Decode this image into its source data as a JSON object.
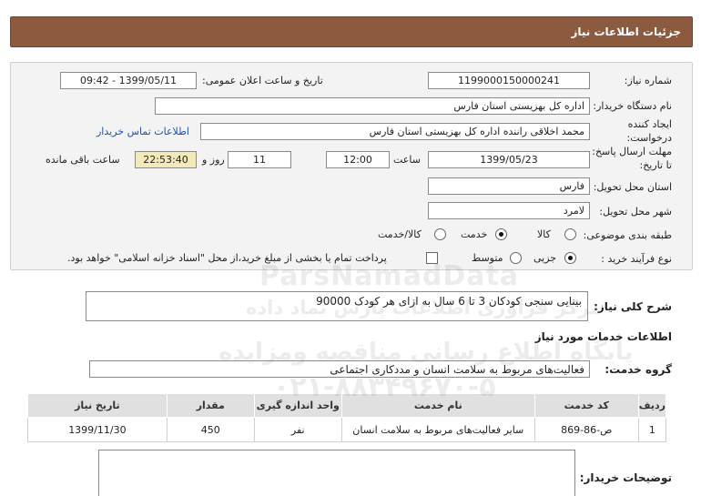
{
  "header": {
    "title": "جزئیات اطلاعات نیاز"
  },
  "form": {
    "need_number_label": "شماره نیاز:",
    "need_number": "1199000150000241",
    "announce_label": "تاریخ و ساعت اعلان عمومی:",
    "announce_value": "1399/05/11 - 09:42",
    "buyer_org_label": "نام دستگاه خریدار:",
    "buyer_org": "اداره کل بهزیستی استان فارس",
    "creator_label_1": "ایجاد کننده",
    "creator_label_2": "درخواست:",
    "creator": "محمد  اخلاقی راننده اداره کل بهزیستی استان فارس",
    "contact_link": "اطلاعات تماس خریدار",
    "deadline_label_1": "مهلت ارسال پاسخ:",
    "deadline_label_2": "تا تاریخ:",
    "deadline_date": "1399/05/23",
    "time_label": "ساعت",
    "deadline_time": "12:00",
    "days": "11",
    "days_label": "روز و",
    "remaining": "22:53:40",
    "remaining_label": "ساعت باقی مانده",
    "province_label": "استان محل تحویل:",
    "province": "فارس",
    "city_label": "شهر محل تحویل:",
    "city": "لامرد",
    "category_label": "طبقه بندی موضوعی:",
    "category_options": [
      "کالا",
      "خدمت",
      "کالا/خدمت"
    ],
    "process_label": "نوع فرآیند خرید :",
    "process_options": [
      "جزیی",
      "متوسط"
    ],
    "process_note": "پرداخت تمام یا بخشی از مبلغ خرید،از محل \"اسناد خزانه اسلامی\" خواهد بود."
  },
  "summary": {
    "label": "شرح کلی نیاز:",
    "text": "بینایی سنجی کودکان 3 تا 6 سال به ازای هر کودک    90000"
  },
  "services": {
    "section_title": "اطلاعات خدمات مورد نیاز",
    "group_label": "گروه خدمت:",
    "group_value": "فعالیت‌های مربوط به سلامت انسان و مددکاری اجتماعی"
  },
  "table": {
    "headers": [
      "ردیف",
      "کد خدمت",
      "نام خدمت",
      "واحد اندازه گیری",
      "مقدار",
      "تاریخ نیاز"
    ],
    "rows": [
      [
        "1",
        "ص-86-869",
        "سایر فعالیت‌های مربوط به سلامت انسان",
        "نفر",
        "450",
        "1399/11/30"
      ]
    ]
  },
  "buyer_notes": {
    "label": "توضیحات خریدار:"
  },
  "watermark": {
    "brand": "ParsNamadData",
    "line1": "مرکز فراوری اطلاعات پارس نماد داده",
    "line2": "پایگاه اطلاع رسانی مناقصه ومزایده",
    "phone": "۰۲۱-۸۸۳۴۹۶۷۰-۵"
  }
}
